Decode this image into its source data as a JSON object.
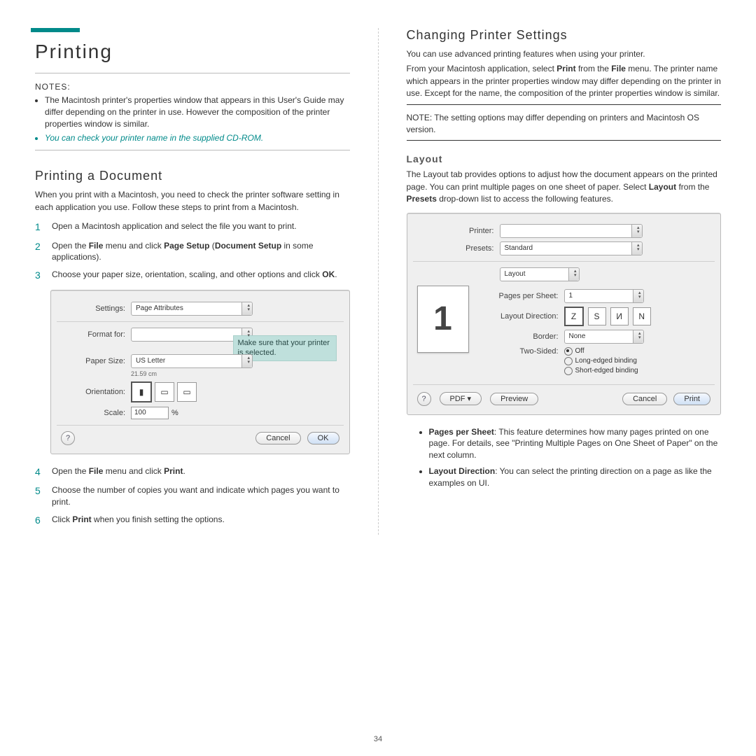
{
  "page_number": "34",
  "left": {
    "title": "Printing",
    "notes_label": "NOTES:",
    "note1": "The Macintosh printer's properties window that appears in this User's Guide may differ depending on the printer in use. However the composition of the printer properties window is similar.",
    "note2": "You can check your printer name in the supplied CD-ROM.",
    "sub_title": "Printing a Document",
    "sub_intro": "When you print with a Macintosh, you need to check the printer software setting in each application you use. Follow these steps to print from a Macintosh.",
    "step1": "Open a Macintosh application and select the file you want to print.",
    "step2_a": "Open the ",
    "step2_b": "File",
    "step2_c": " menu and click ",
    "step2_d": "Page Setup",
    "step2_e": " (",
    "step2_f": "Document Setup",
    "step2_g": " in some applications).",
    "step3": "Choose your paper size, orientation, scaling, and other options and click ",
    "step3_ok": "OK",
    "step3_dot": ".",
    "step4_a": "Open the ",
    "step4_b": "File",
    "step4_c": " menu and click ",
    "step4_d": "Print",
    "step4_e": ".",
    "step5": "Choose the number of copies you want and indicate which pages you want to print.",
    "step6_a": "Click ",
    "step6_b": "Print",
    "step6_c": " when you finish setting the options.",
    "pagesetup": {
      "settings_label": "Settings:",
      "settings_value": "Page Attributes",
      "format_label": "Format for:",
      "paper_label": "Paper Size:",
      "paper_value": "US Letter",
      "paper_dims": "21.59 cm",
      "orient_label": "Orientation:",
      "scale_label": "Scale:",
      "scale_value": "100",
      "scale_pct": "%",
      "cancel": "Cancel",
      "ok": "OK",
      "callout": "Make sure that your printer is selected."
    }
  },
  "right": {
    "title": "Changing Printer Settings",
    "p1": "You can use advanced printing features when using your printer.",
    "p2_a": "From your Macintosh application, select ",
    "p2_b": "Print",
    "p2_c": " from the ",
    "p2_d": "File",
    "p2_e": " menu. The printer name which appears in the printer properties window may differ depending on the printer in use. Except for the name, the composition of the printer properties window is similar.",
    "note_a": "NOTE",
    "note_b": ": The setting options may differ depending on printers and Macintosh OS version.",
    "layout_title": "Layout",
    "layout_intro_a": "The Layout tab provides options to adjust how the document appears on the printed page. You can print multiple pages on one sheet of paper. Select ",
    "layout_intro_b": "Layout",
    "layout_intro_c": " from the ",
    "layout_intro_d": "Presets",
    "layout_intro_e": " drop-down list to access the following features.",
    "dialog": {
      "printer_label": "Printer:",
      "presets_label": "Presets:",
      "presets_value": "Standard",
      "section_value": "Layout",
      "pps_label": "Pages per Sheet:",
      "pps_value": "1",
      "dir_label": "Layout Direction:",
      "border_label": "Border:",
      "border_value": "None",
      "two_label": "Two-Sided:",
      "opt_off": "Off",
      "opt_long": "Long-edged binding",
      "opt_short": "Short-edged binding",
      "pdf": "PDF ▾",
      "preview": "Preview",
      "cancel": "Cancel",
      "print": "Print",
      "big1": "1"
    },
    "b1_a": "Pages per Sheet",
    "b1_b": ": This feature determines how many pages printed on one page. For details, see \"Printing Multiple Pages on One Sheet of Paper\" on the next column.",
    "b2_a": "Layout Direction",
    "b2_b": ": You can select the printing direction on a page as like the examples on UI."
  }
}
